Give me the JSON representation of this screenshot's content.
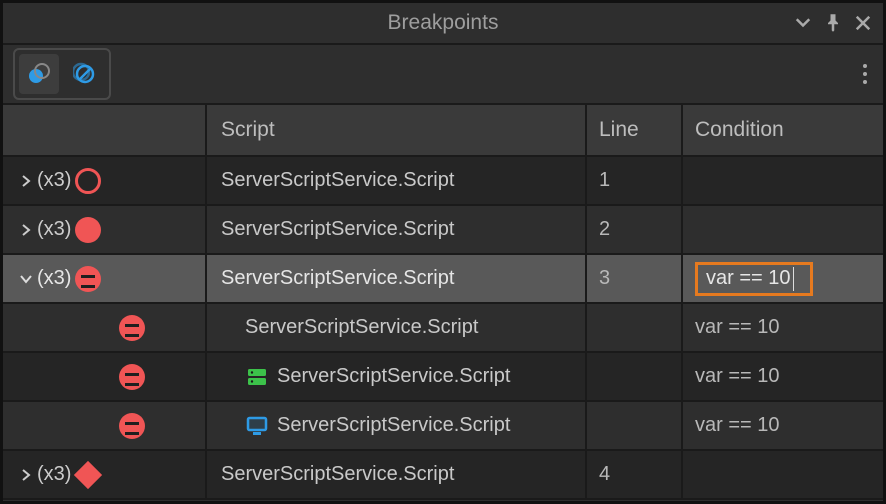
{
  "title": "Breakpoints",
  "columns": {
    "tree": "",
    "script": "Script",
    "line": "Line",
    "condition": "Condition"
  },
  "rows": [
    {
      "expand": "collapsed",
      "count": "(x3)",
      "bp": "outline",
      "indent": 0,
      "ctx": "",
      "script": "ServerScriptService.Script",
      "line": "1",
      "condition": "",
      "selected": false,
      "alt": false
    },
    {
      "expand": "collapsed",
      "count": "(x3)",
      "bp": "filled",
      "indent": 0,
      "ctx": "",
      "script": "ServerScriptService.Script",
      "line": "2",
      "condition": "",
      "selected": false,
      "alt": true
    },
    {
      "expand": "expanded",
      "count": "(x3)",
      "bp": "cond",
      "indent": 0,
      "ctx": "",
      "script": "ServerScriptService.Script",
      "line": "3",
      "condition": "var == 10",
      "selected": true,
      "editing": true,
      "alt": false
    },
    {
      "expand": "",
      "count": "",
      "bp": "cond",
      "indent": 1,
      "ctx": "",
      "script": "ServerScriptService.Script",
      "line": "",
      "condition": "var == 10",
      "selected": false,
      "alt": true
    },
    {
      "expand": "",
      "count": "",
      "bp": "cond",
      "indent": 1,
      "ctx": "server",
      "script": "ServerScriptService.Script",
      "line": "",
      "condition": "var == 10",
      "selected": false,
      "alt": false
    },
    {
      "expand": "",
      "count": "",
      "bp": "cond",
      "indent": 1,
      "ctx": "client",
      "script": "ServerScriptService.Script",
      "line": "",
      "condition": "var == 10",
      "selected": false,
      "alt": true
    },
    {
      "expand": "collapsed",
      "count": "(x3)",
      "bp": "diamond",
      "indent": 0,
      "ctx": "",
      "script": "ServerScriptService.Script",
      "line": "4",
      "condition": "",
      "selected": false,
      "alt": false
    }
  ]
}
